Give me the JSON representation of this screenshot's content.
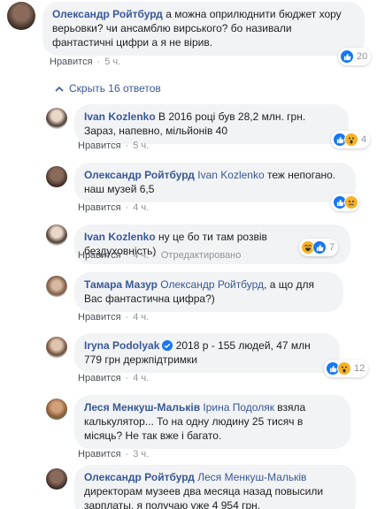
{
  "comments": [
    {
      "name": "Олександр Ройтбурд",
      "text": " а можна оприлюднити бюджет хору верьовки? чи ансамблю вирського? бо називали фантастичні цифри а я не вірив.",
      "like": "Нравится",
      "time": "5 ч.",
      "react_count": "20"
    },
    {
      "name": "Ivan Kozlenko",
      "text": " В 2016 році був 28,2 млн. грн. Зараз, напевно, мільйонів 40",
      "like": "Нравится",
      "time": "5 ч.",
      "react_count": "4"
    },
    {
      "name": "Олександр Ройтбурд",
      "mention": "Ivan Kozlenko",
      "text": " теж непогано. наш музей 6,5",
      "like": "Нравится",
      "time": "4 ч."
    },
    {
      "name": "Ivan Kozlenko",
      "text": " ну це бо ти там розвів бездуховність)",
      "like": "Нравится",
      "time": "4 ч.",
      "edited": "Отредактировано",
      "react_count": "7"
    },
    {
      "name": "Тамара Мазур",
      "mention": "Олександр Ройтбурд",
      "text": ", а що для Вас фантастична цифра?)",
      "like": "Нравится",
      "time": "4 ч."
    },
    {
      "name": "Iryna Podolyak",
      "text": " 2018 р - 155 людей, 47 млн 779 грн держпідтримки",
      "like": "Нравится",
      "time": "4 ч.",
      "react_count": "12"
    },
    {
      "name": "Леся Менкуш-Мальків",
      "mention": "Ірина Подоляк",
      "text": " взяла калькулятор... То на одну людину 25 тисяч в місяць? Не так вже і багато.",
      "like": "Нравится",
      "time": "3 ч."
    },
    {
      "name": "Олександр Ройтбурд",
      "mention": "Леся Менкуш-Мальків",
      "text": " директорам музеев два месяца назад повысили зарплаты. я получаю уже 4 954 грн."
    }
  ],
  "hide_replies": "Скрыть 16 ответов",
  "colors": {
    "link": "#385898",
    "bubble": "#f2f3f5",
    "like_blue": "#1877f2",
    "emoji_yellow": "#f7b125"
  }
}
